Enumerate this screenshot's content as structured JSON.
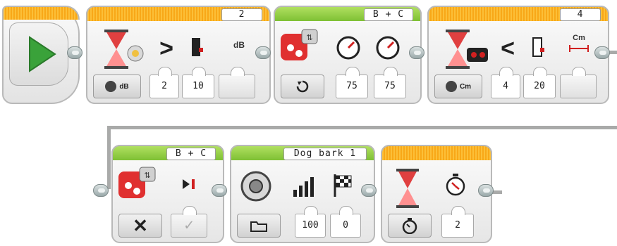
{
  "row1": {
    "wait_sound": {
      "port": "2",
      "mode_unit": "dB",
      "compare_symbol": ">",
      "unit_label": "dB",
      "params": [
        "2",
        "10"
      ]
    },
    "tank_motor": {
      "ports": "B + C",
      "params": [
        "75",
        "75"
      ]
    },
    "wait_ultrasonic": {
      "port": "4",
      "mode_unit": "Cm",
      "compare_symbol": "<",
      "unit_label": "Cm",
      "params": [
        "4",
        "20"
      ]
    }
  },
  "row2": {
    "tank_motor_off": {
      "ports": "B + C"
    },
    "sound": {
      "file": "Dog bark 1",
      "params": [
        "100",
        "0"
      ]
    },
    "wait_time": {
      "params": [
        "2"
      ]
    }
  },
  "colors": {
    "wait_header": "#f9b028",
    "action_header": "#7ec034",
    "start_arrow": "#3aa23a",
    "wire": "#a9aaa9"
  }
}
